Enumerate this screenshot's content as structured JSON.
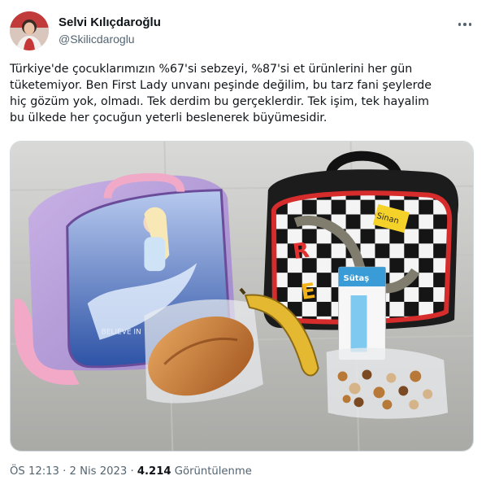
{
  "author": {
    "display_name": "Selvi Kılıçdaroğlu",
    "handle": "@Skilicdaroglu",
    "avatar_icon": "profile-photo"
  },
  "more_icon": "more-horizontal-icon",
  "tweet": {
    "lines": [
      "Türkiye'de çocuklarımızın %67'si sebzeyi, %87'si et ürünlerini her gün",
      "tüketemiyor. Ben First Lady unvanı peşinde değilim, bu tarz fani şeylerde",
      "hiç gözüm yok, olmadı. Tek derdim bu gerçeklerdir. Tek işim, tek hayalim",
      "bu ülkede her çocuğun yeterli beslenerek büyümesidir."
    ]
  },
  "media": {
    "left_bag_text": "BELIEVE IN",
    "right_bag_tag": "Sinan",
    "milk_brand": "Sütaş"
  },
  "meta": {
    "time": "ÖS 12:13",
    "separator": " · ",
    "date": "2 Nis 2023",
    "views_count": "4.214",
    "views_label": "Görüntülenme"
  },
  "colors": {
    "text_primary": "#0f1419",
    "text_secondary": "#536471",
    "border": "#cfd9de"
  }
}
